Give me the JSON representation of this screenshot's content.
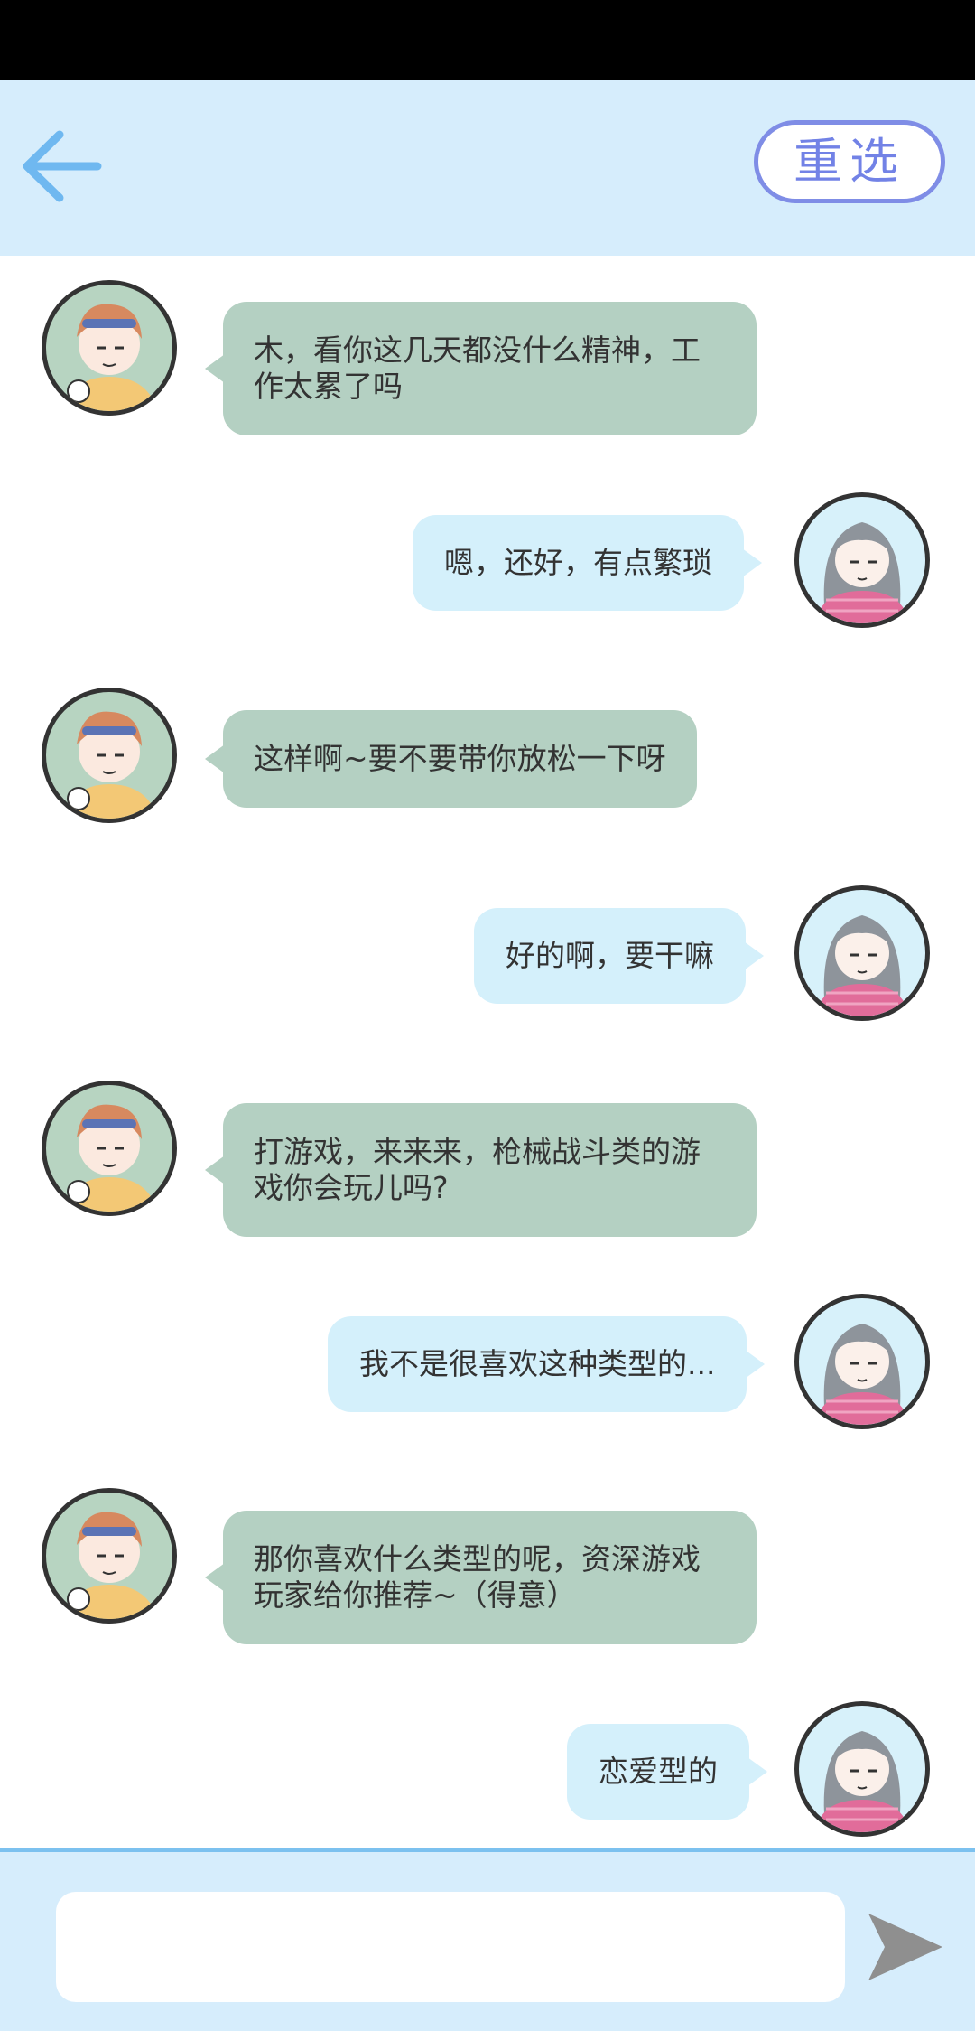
{
  "header": {
    "back_icon": "arrow-left-icon",
    "reselect_label": "重选",
    "accent_color": "#6fb8f0"
  },
  "messages": [
    {
      "side": "left",
      "avatar": "boy-avatar",
      "text": "木，看你这几天都没什么精神，工作太累了吗"
    },
    {
      "side": "right",
      "avatar": "girl-avatar",
      "text": "嗯，还好，有点繁琐"
    },
    {
      "side": "left",
      "avatar": "boy-avatar",
      "text": "这样啊~要不要带你放松一下呀"
    },
    {
      "side": "right",
      "avatar": "girl-avatar",
      "text": "好的啊，要干嘛"
    },
    {
      "side": "left",
      "avatar": "boy-avatar",
      "text": "打游戏，来来来，枪械战斗类的游戏你会玩儿吗?"
    },
    {
      "side": "right",
      "avatar": "girl-avatar",
      "text": "我不是很喜欢这种类型的..."
    },
    {
      "side": "left",
      "avatar": "boy-avatar",
      "text": "那你喜欢什么类型的呢，资深游戏玩家给你推荐~（得意）"
    },
    {
      "side": "right",
      "avatar": "girl-avatar",
      "text": "恋爱型的"
    }
  ],
  "composer": {
    "input_value": "",
    "input_placeholder": "",
    "send_icon": "send-arrow-icon"
  },
  "colors": {
    "left_bubble": "#b4d0c2",
    "right_bubble": "#d4f0fb",
    "bar_background": "#d6edfc"
  }
}
